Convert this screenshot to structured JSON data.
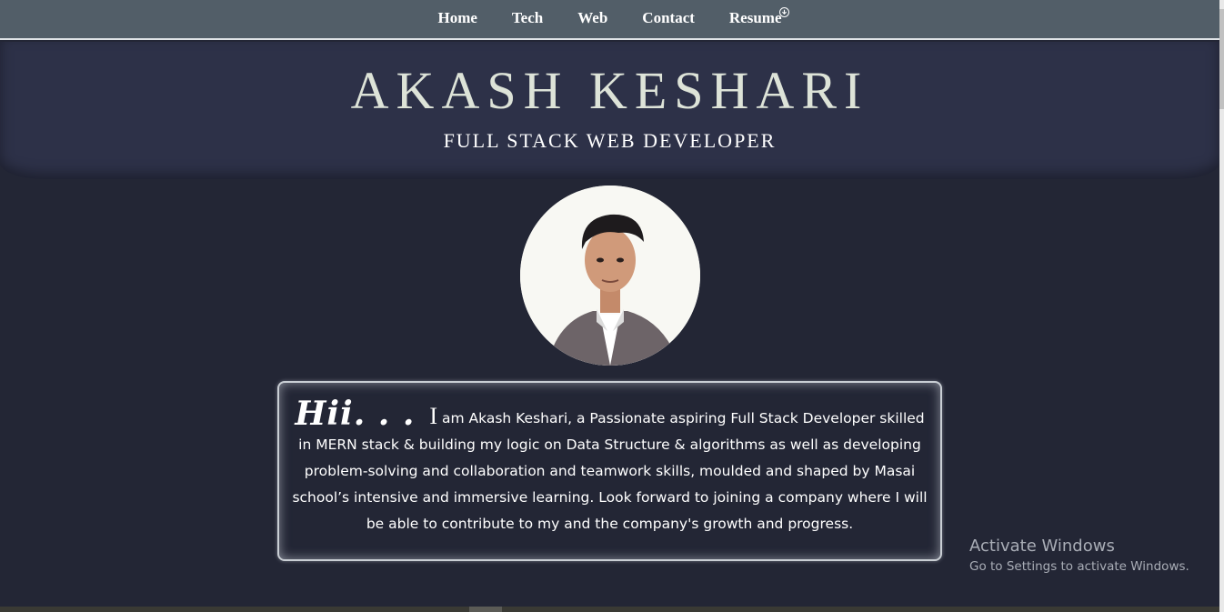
{
  "nav": {
    "items": [
      {
        "label": "Home"
      },
      {
        "label": "Tech"
      },
      {
        "label": "Web"
      },
      {
        "label": "Contact"
      },
      {
        "label": "Resume",
        "icon": "download-icon"
      }
    ]
  },
  "hero": {
    "name": "AKASH KESHARI",
    "subtitle": "FULL STACK WEB DEVELOPER"
  },
  "about": {
    "greeting": "Hii. . .",
    "lead_letter": "I",
    "text": " am Akash Keshari, a Passionate aspiring Full Stack Developer skilled in MERN stack & building my logic on Data Structure & algorithms as well as developing problem-solving and collaboration and teamwork skills, moulded and shaped by Masai school’s intensive and immersive learning. Look forward to joining a company where I will be able to contribute to my and the company's growth and progress."
  },
  "watermark": {
    "title": "Activate Windows",
    "subtitle": "Go to Settings to activate Windows."
  },
  "colors": {
    "nav_bg": "#525e68",
    "hero_bg": "#2d3148",
    "page_bg": "#232635"
  }
}
